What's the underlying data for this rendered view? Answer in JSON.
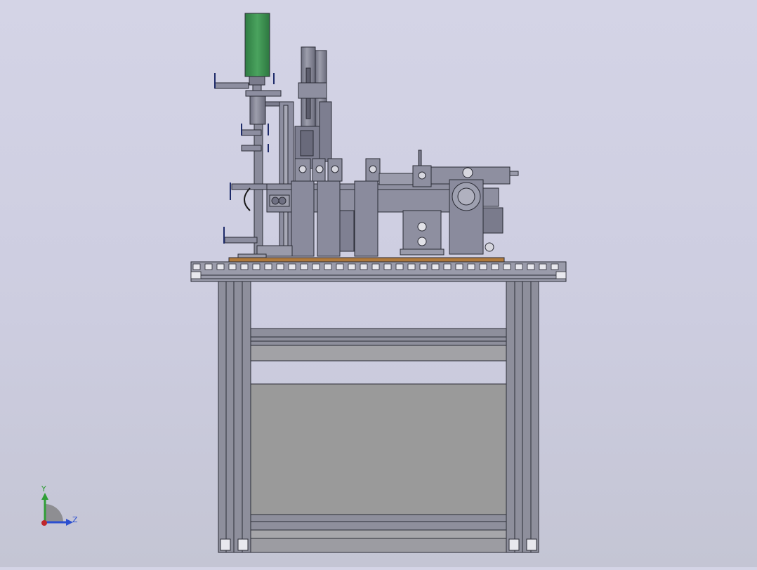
{
  "viewport": {
    "background_top": "#d4d4e6",
    "background_bottom": "#c4c5d4"
  },
  "model": {
    "frame_color": "#8e8f9c",
    "panel_color": "#9a9a9a",
    "part_color": "#83849a",
    "motor_color": "#3f9553",
    "base_plate_color": "#b07a3c"
  },
  "triad": {
    "y_label": "Y",
    "z_label": "Z",
    "y_color": "#2f9e36",
    "z_color": "#2c4fd0",
    "x_color": "#c0262b"
  }
}
